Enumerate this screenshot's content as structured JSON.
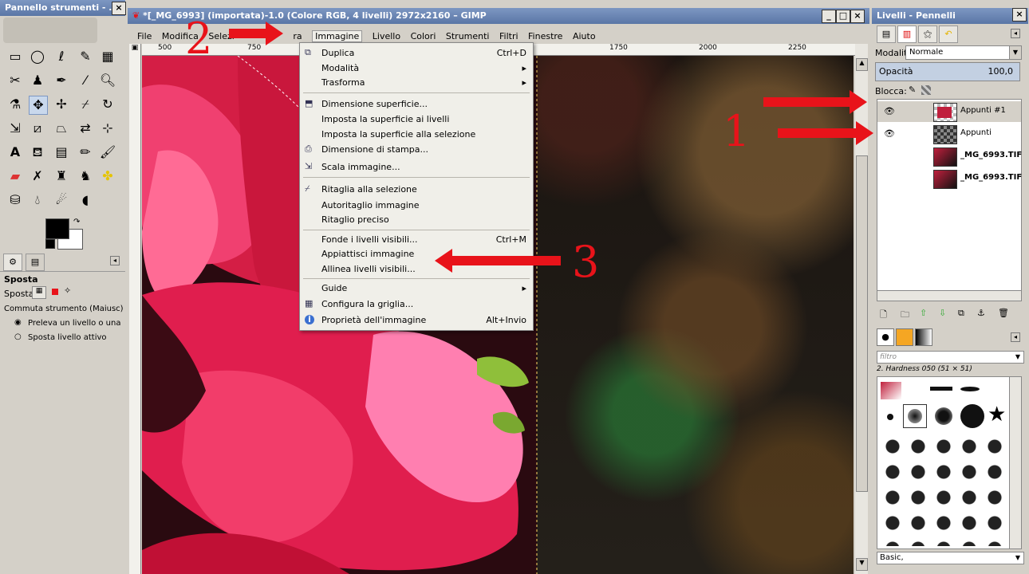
{
  "toolbox": {
    "title": "Pannello strumenti - ...",
    "close": "×",
    "tool_options_title": "Sposta",
    "move_label": "Sposta:",
    "toggle_label": "Commuta strumento (Maiusc)",
    "option1": "Preleva un livello o una guid",
    "option2": "Sposta livello attivo"
  },
  "image_window": {
    "title": "*[_MG_6993] (importata)-1.0 (Colore RGB, 4 livelli) 2972x2160 – GIMP",
    "btn_min": "_",
    "btn_max": "□",
    "btn_close": "×",
    "menus": [
      "File",
      "Modifica",
      "Selezi",
      "ra",
      "Immagine",
      "Livello",
      "Colori",
      "Strumenti",
      "Filtri",
      "Finestre",
      "Aiuto"
    ],
    "ruler_ticks": [
      "500",
      "750",
      "1750",
      "2000",
      "2250"
    ]
  },
  "image_menu": {
    "items": [
      {
        "label": "Duplica",
        "shortcut": "Ctrl+D",
        "icon": "duplicate-icon"
      },
      {
        "label": "Modalità",
        "shortcut": "▸"
      },
      {
        "label": "Trasforma",
        "shortcut": "▸"
      },
      {
        "label": "Dimensione superficie...",
        "icon": "canvas-size-icon"
      },
      {
        "label": "Imposta la superficie ai livelli"
      },
      {
        "label": "Imposta la superficie alla selezione"
      },
      {
        "label": "Dimensione di stampa...",
        "icon": "print-size-icon"
      },
      {
        "label": "Scala immagine...",
        "icon": "scale-icon"
      },
      {
        "label": "Ritaglia alla selezione",
        "icon": "crop-icon"
      },
      {
        "label": "Autoritaglio immagine"
      },
      {
        "label": "Ritaglio preciso"
      },
      {
        "label": "Fonde i livelli visibili...",
        "shortcut": "Ctrl+M"
      },
      {
        "label": "Appiattisci immagine"
      },
      {
        "label": "Allinea livelli visibili..."
      },
      {
        "label": "Guide",
        "shortcut": "▸"
      },
      {
        "label": "Configura la griglia...",
        "icon": "grid-icon"
      },
      {
        "label": "Proprietà dell'immagine",
        "shortcut": "Alt+Invio",
        "icon": "info-icon"
      }
    ]
  },
  "dock": {
    "title": "Livelli - Pennelli",
    "close": "×",
    "mode_label": "Modalità:",
    "mode_value": "Normale",
    "opacity_label": "Opacità",
    "opacity_value": "100,0",
    "lock_label": "Blocca:",
    "layers": [
      {
        "name": "Appunti #1",
        "visible": true
      },
      {
        "name": "Appunti",
        "visible": true
      },
      {
        "name": "_MG_6993.TIF",
        "visible": false
      },
      {
        "name": "_MG_6993.TIF",
        "visible": false
      }
    ],
    "filter_placeholder": "filtro",
    "brush_name": "2. Hardness 050 (51 × 51)",
    "brush_tag": "Basic,"
  },
  "annotations": {
    "one": "1",
    "two": "2",
    "three": "3"
  },
  "colors": {
    "accent_red": "#e8131a",
    "title_blue": "#6a85b3",
    "menu_bg": "#f0efe9"
  }
}
